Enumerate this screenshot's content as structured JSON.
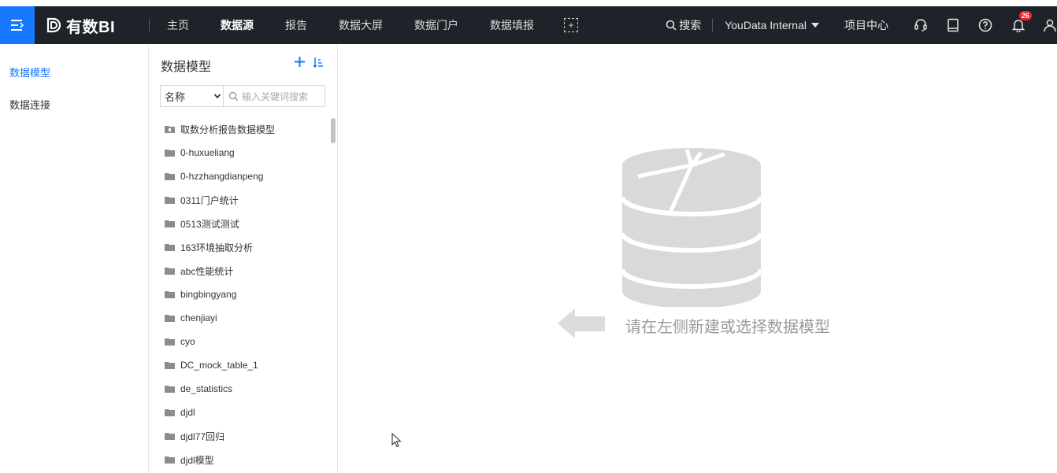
{
  "app": {
    "logo_text": "有数BI"
  },
  "header": {
    "nav": [
      "主页",
      "数据源",
      "报告",
      "数据大屏",
      "数据门户",
      "数据填报"
    ],
    "active_nav": "数据源",
    "search_label": "搜索",
    "tenant": "YouData Internal",
    "project_center": "项目中心",
    "notification_count": "26"
  },
  "leftnav": {
    "items": [
      "数据模型",
      "数据连接"
    ],
    "active": "数据模型"
  },
  "panel": {
    "title": "数据模型",
    "filter_select_value": "名称",
    "search_placeholder": "输入关键词搜索",
    "items": [
      "取数分析报告数据模型",
      "0-huxueliang",
      "0-hzzhangdianpeng",
      "0311门户统计",
      "0513测试测试",
      "163环境抽取分析",
      "abc性能统计",
      "bingbingyang",
      "chenjiayi",
      "cyo",
      "DC_mock_table_1",
      "de_statistics",
      "djdl",
      "djdl77回归",
      "djdl模型"
    ]
  },
  "main": {
    "empty_text": "请在左侧新建或选择数据模型"
  },
  "colors": {
    "accent": "#1677ff",
    "topbar": "#1f2329",
    "badge": "#f5222d",
    "placeholder_gray": "#d9d9d9"
  }
}
